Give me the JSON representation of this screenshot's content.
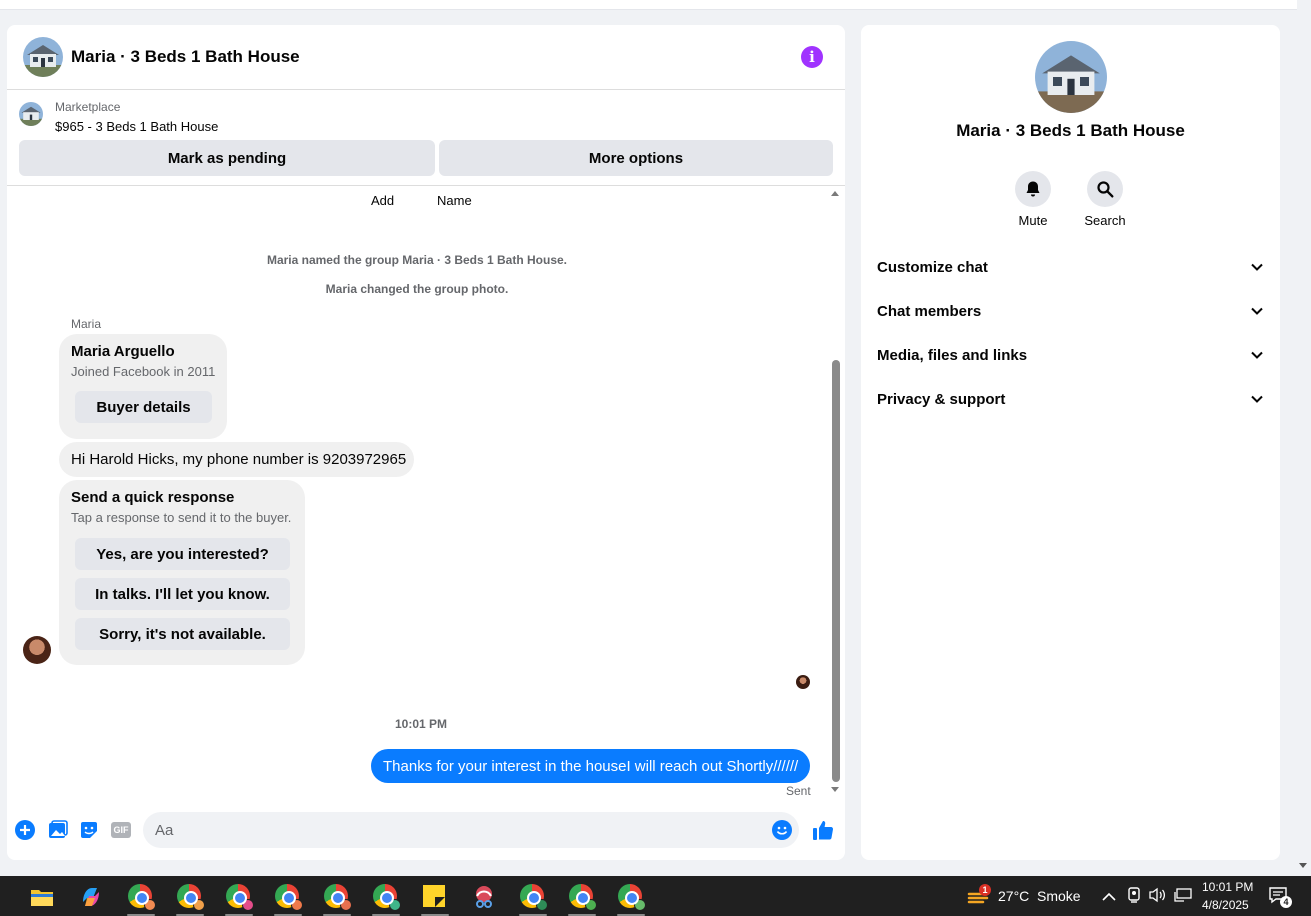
{
  "chat": {
    "title": "Maria · 3 Beds 1 Bath House",
    "marketplace_label": "Marketplace",
    "marketplace_listing": "$965 - 3 Beds 1 Bath House",
    "mark_pending_label": "Mark as pending",
    "more_options_label": "More options",
    "top_actions": [
      "Add",
      "Name"
    ],
    "system_messages": [
      "Maria named the group Maria · 3 Beds 1 Bath House.",
      "Maria changed the group photo."
    ],
    "sender_name": "Maria",
    "buyer_card": {
      "name": "Maria Arguello",
      "joined": "Joined Facebook in 2011",
      "button": "Buyer details"
    },
    "phone_message": "Hi Harold Hicks, my phone number is 9203972965",
    "quick_response": {
      "title": "Send a quick response",
      "subtitle": "Tap a response to send it to the buyer.",
      "options": [
        "Yes, are you interested?",
        "In talks. I'll let you know.",
        "Sorry, it's not available."
      ]
    },
    "timestamp": "10:01 PM",
    "outgoing_message": "Thanks for your interest in the houseI will reach out Shortly//////",
    "sent_status": "Sent",
    "composer_placeholder": "Aa",
    "composer_icons": [
      "plus-icon",
      "photo-icon",
      "sticker-icon",
      "gif-icon",
      "emoji-icon",
      "thumbs-up-icon"
    ],
    "accent_color": "#0a7cff"
  },
  "info_panel": {
    "name": "Maria · 3 Beds 1 Bath House",
    "mute_label": "Mute",
    "search_label": "Search",
    "sections": [
      "Customize chat",
      "Chat members",
      "Media, files and links",
      "Privacy & support"
    ]
  },
  "taskbar": {
    "weather_temp": "27°C",
    "weather_desc": "Smoke",
    "weather_badge": "1",
    "time": "10:01 PM",
    "date": "4/8/2025",
    "notification_count": "4",
    "gif_label": "GIF"
  }
}
